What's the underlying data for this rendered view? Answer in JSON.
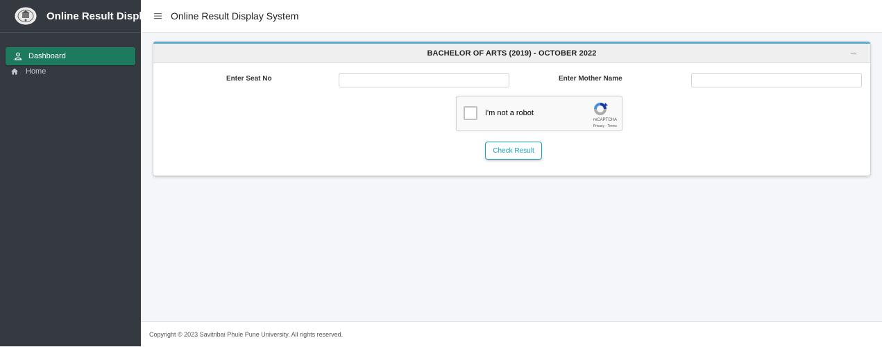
{
  "app": {
    "brand_title": "Online Result Display System",
    "header_title": "Online Result Display System"
  },
  "sidebar": {
    "items": [
      {
        "label": "Dashboard",
        "icon": "user-icon",
        "active": true
      },
      {
        "label": "Home",
        "icon": "home-icon",
        "active": false
      }
    ]
  },
  "card": {
    "title": "BACHELOR OF ARTS (2019) - OCTOBER 2022",
    "collapse_icon": "minus-icon",
    "seat_label": "Enter Seat No",
    "seat_value": "",
    "mother_label": "Enter Mother Name",
    "mother_value": "",
    "captcha_text": "I'm not a robot",
    "captcha_brand": "reCAPTCHA",
    "captcha_terms": "Privacy - Terms",
    "submit_label": "Check Result"
  },
  "footer": {
    "text": "Copyright © 2023 Savitribai Phule Pune University. All rights reserved."
  },
  "colors": {
    "sidebar_bg": "#343a40",
    "active_item": "#1e7a5f",
    "card_accent": "#5bb0c9",
    "button_accent": "#17a2b8"
  }
}
